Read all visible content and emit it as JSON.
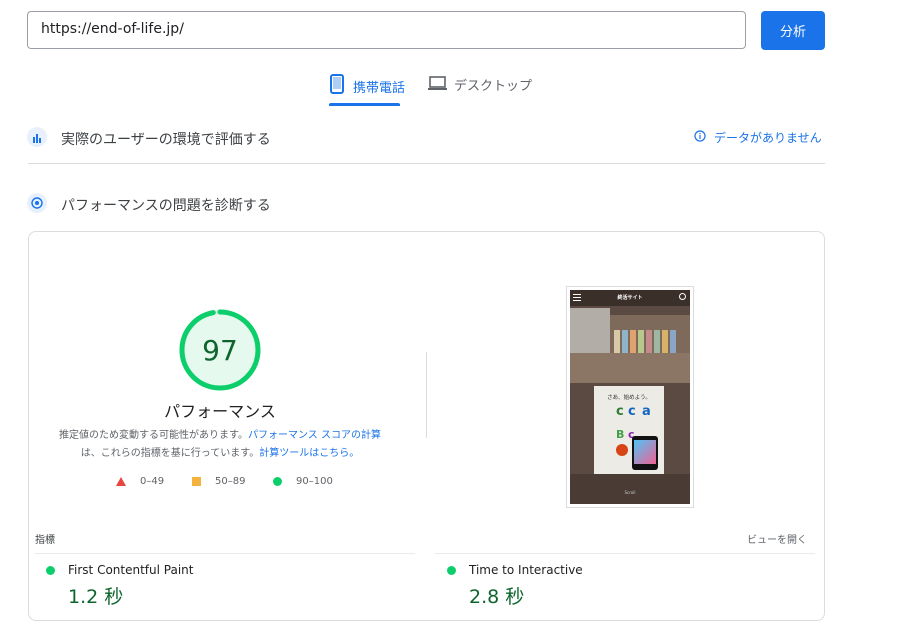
{
  "search": {
    "url": "https://end-of-life.jp/",
    "analyze_label": "分析"
  },
  "tabs": [
    {
      "label": "携帯電話",
      "icon": "mobile-icon",
      "active": true
    },
    {
      "label": "デスクトップ",
      "icon": "laptop-icon",
      "active": false
    }
  ],
  "field_data": {
    "title": "実際のユーザーの環境で評価する",
    "status": "データがありません",
    "icon": "field-data-icon"
  },
  "lab_data": {
    "title": "パフォーマンスの問題を診断する",
    "icon": "diagnose-icon"
  },
  "score": {
    "value": "97",
    "fraction": 0.97,
    "label": "パフォーマンス",
    "note_prefix": "推定値のため変動する可能性があります。",
    "note_link1": "パフォーマンス スコアの計算",
    "note_mid": "は、これらの指標を基に行っています。",
    "note_link2": "計算ツールはこちら。",
    "color": "#0cce6b"
  },
  "legend": [
    {
      "range": "0–49",
      "color": "#e8453c",
      "shape": "triangle"
    },
    {
      "range": "50–89",
      "color": "#f4b23f",
      "shape": "square"
    },
    {
      "range": "90–100",
      "color": "#0cce6b",
      "shape": "circle"
    }
  ],
  "screenshot": {
    "header_title": "終活サイト",
    "banner_text": "さあ、始めよう。",
    "footer_text": "Scroll"
  },
  "metrics": {
    "heading": "指標",
    "view_link": "ビューを開く",
    "items": [
      {
        "name": "First Contentful Paint",
        "value": "1.2 秒"
      },
      {
        "name": "Time to Interactive",
        "value": "2.8 秒"
      }
    ]
  }
}
